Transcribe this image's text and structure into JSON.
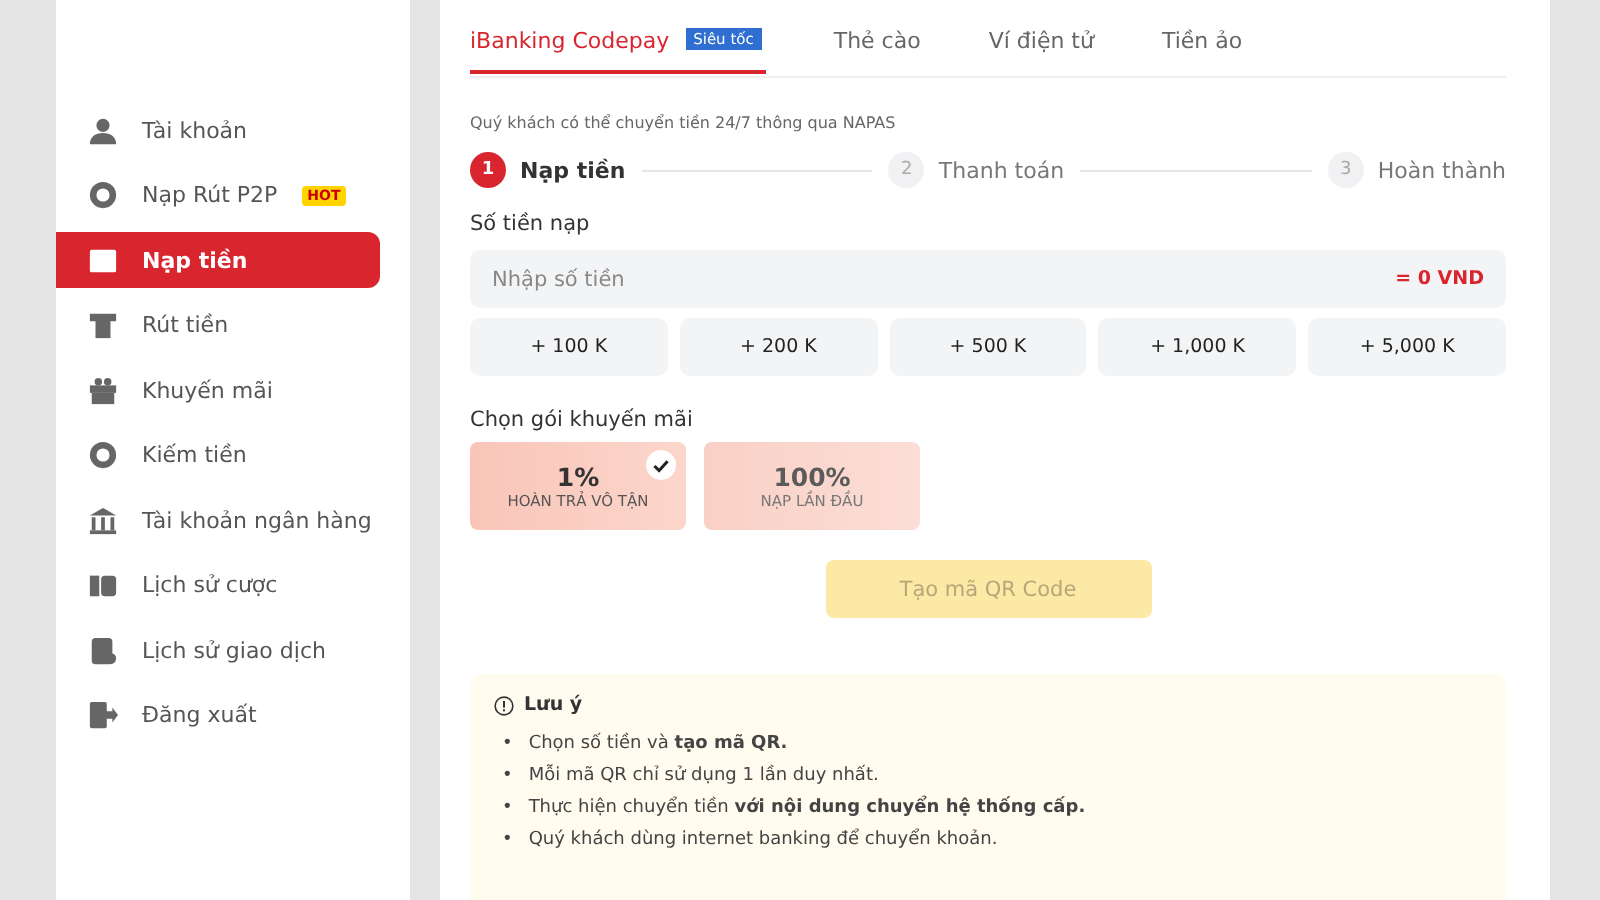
{
  "sidebar": {
    "items": [
      {
        "label": "Tài khoản",
        "selected": false
      },
      {
        "label": "Nạp Rút P2P",
        "badge": "HOT",
        "selected": false
      },
      {
        "label": "Nạp tiền",
        "selected": true
      },
      {
        "label": "Rút tiền",
        "selected": false
      },
      {
        "label": "Khuyến mãi",
        "selected": false
      },
      {
        "label": "Kiếm tiền",
        "selected": false
      },
      {
        "label": "Tài khoản ngân hàng",
        "selected": false
      },
      {
        "label": "Lịch sử cược",
        "selected": false
      },
      {
        "label": "Lịch sử giao dịch",
        "selected": false
      },
      {
        "label": "Đăng xuất",
        "selected": false
      }
    ]
  },
  "tabs": [
    {
      "label": "iBanking Codepay",
      "badge": "Siêu tốc",
      "selected": true
    },
    {
      "label": "Thẻ cào",
      "selected": false
    },
    {
      "label": "Ví điện tử",
      "selected": false
    },
    {
      "label": "Tiền ảo",
      "selected": false
    }
  ],
  "note": "Quý khách có thể chuyển tiền 24/7 thông qua NAPAS",
  "steps": [
    {
      "number": "1",
      "label": "Nạp tiền",
      "selected": true
    },
    {
      "number": "2",
      "label": "Thanh toán",
      "selected": false
    },
    {
      "number": "3",
      "label": "Hoàn thành",
      "selected": false
    }
  ],
  "amount": {
    "label": "Số tiền nạp",
    "placeholder": "Nhập số tiền",
    "total": "= 0 VND"
  },
  "quick_amounts": [
    "+ 100 K",
    "+ 200 K",
    "+ 500 K",
    "+ 1,000 K",
    "+ 5,000 K"
  ],
  "promotions": {
    "label": "Chọn gói khuyến mãi",
    "items": [
      {
        "value": "1%",
        "caption": "HOÀN TRẢ VÔ TẬN",
        "selected": true
      },
      {
        "value": "100%",
        "caption": "NẠP LẦN ĐẦU",
        "selected": false
      }
    ]
  },
  "qr_button": {
    "label": "Tạo mã QR Code",
    "disabled": true
  },
  "notice": {
    "title": "Lưu ý",
    "items": [
      {
        "bullet": "•",
        "text": "Chọn số tiền và **tạo mã QR.**"
      },
      {
        "bullet": "•",
        "text": "Mỗi mã QR chỉ sử dụng 1 lần duy nhất."
      },
      {
        "bullet": "•",
        "text": "Thực hiện chuyển tiền **với nội dung chuyển hệ thống cấp.**"
      },
      {
        "bullet": "•",
        "text": "Quý khách dùng internet banking để chuyển khoản."
      }
    ]
  }
}
